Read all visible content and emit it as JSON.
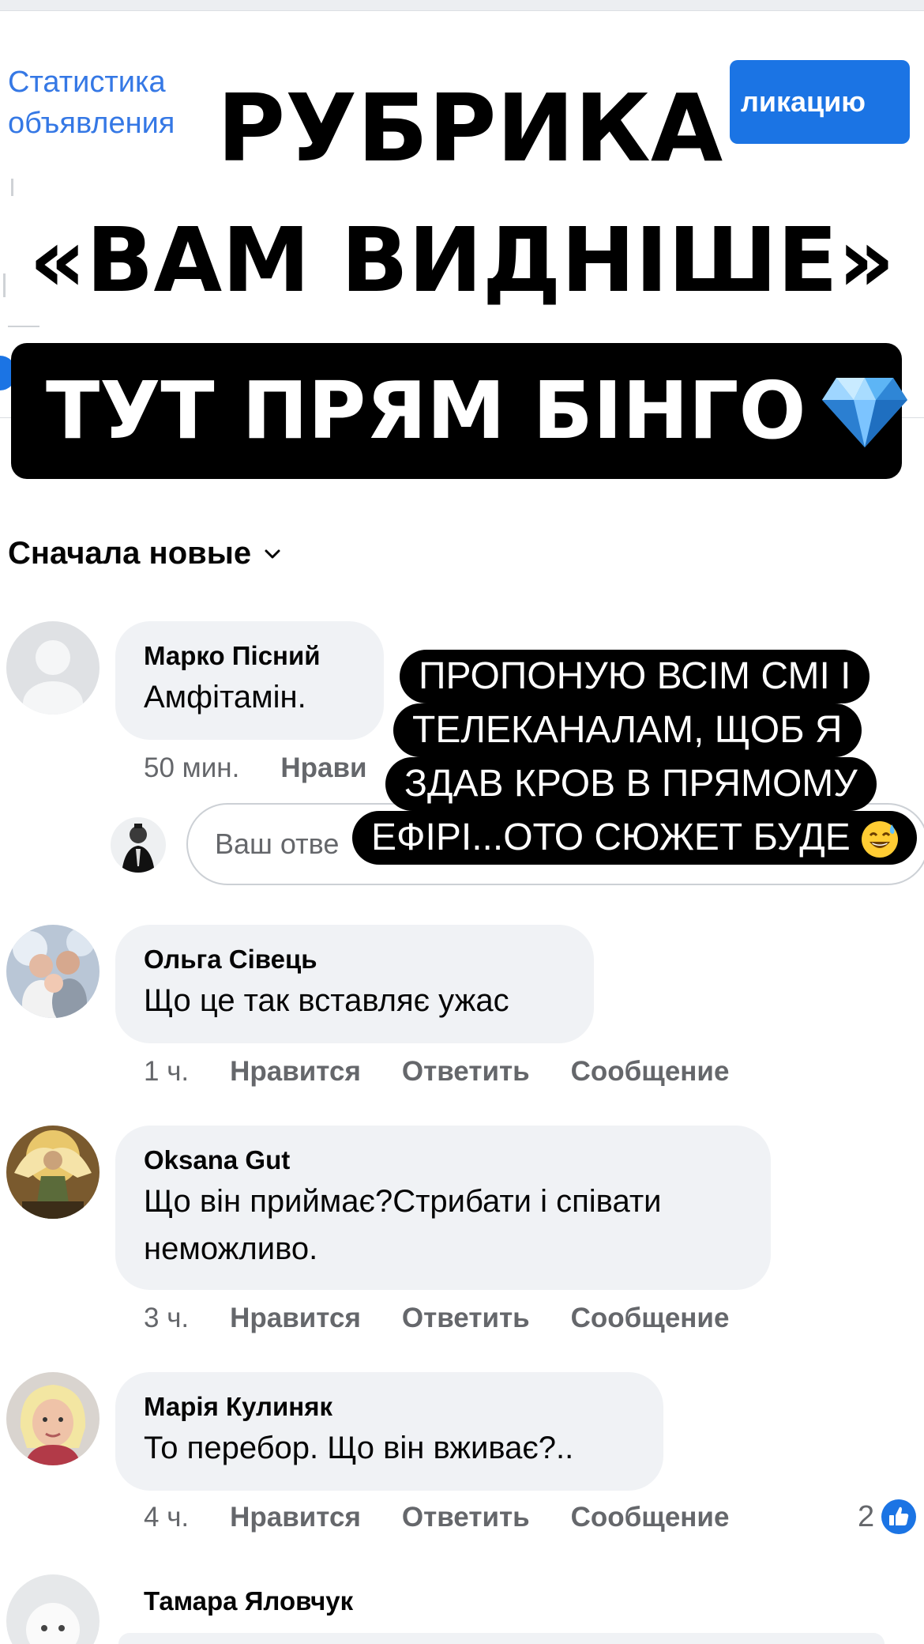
{
  "header": {
    "stats_link_line1": "Статистика",
    "stats_link_line2": "объявления",
    "publish_button": "ликацию"
  },
  "overlay": {
    "title_line1": "РУБРИКА",
    "title_line2": "«ВАМ ВИДНІШЕ»",
    "banner_text": "ТУТ ПРЯМ БІНГО",
    "banner_icon": "gem-icon",
    "quote_lines": [
      "ПРОПОНУЮ ВСІМ СМІ І",
      "ТЕЛЕКАНАЛАМ, ЩОБ Я",
      "ЗДАВ КРОВ В ПРЯМОМУ",
      "ЕФІРІ...ОТО СЮЖЕТ БУДЕ"
    ],
    "quote_icon": "sweat-smile-emoji"
  },
  "sort": {
    "label": "Сначала новые"
  },
  "reply_box": {
    "placeholder": "Ваш отве"
  },
  "comments": [
    {
      "name": "Марко Пісний",
      "text": [
        "Амфітамін."
      ],
      "time": "50 мин.",
      "like": "Нрави"
    },
    {
      "name": "Ольга Сівець",
      "text": [
        "Що це так вставляє ужас"
      ],
      "time": "1 ч.",
      "like": "Нравится",
      "reply": "Ответить",
      "message": "Сообщение"
    },
    {
      "name": "Oksana Gut",
      "text": [
        "Що він приймає?Стрибати і співати",
        "неможливо."
      ],
      "time": "3 ч.",
      "like": "Нравится",
      "reply": "Ответить",
      "message": "Сообщение"
    },
    {
      "name": "Марія Кулиняк",
      "text": [
        "То перебор. Що він вживає?.."
      ],
      "time": "4 ч.",
      "like": "Нравится",
      "reply": "Ответить",
      "message": "Сообщение",
      "reactions": "2"
    },
    {
      "name": "Тамара Яловчук"
    }
  ],
  "colors": {
    "accent": "#1b74e4",
    "bubble": "#f0f2f5",
    "meta": "#65676b"
  }
}
